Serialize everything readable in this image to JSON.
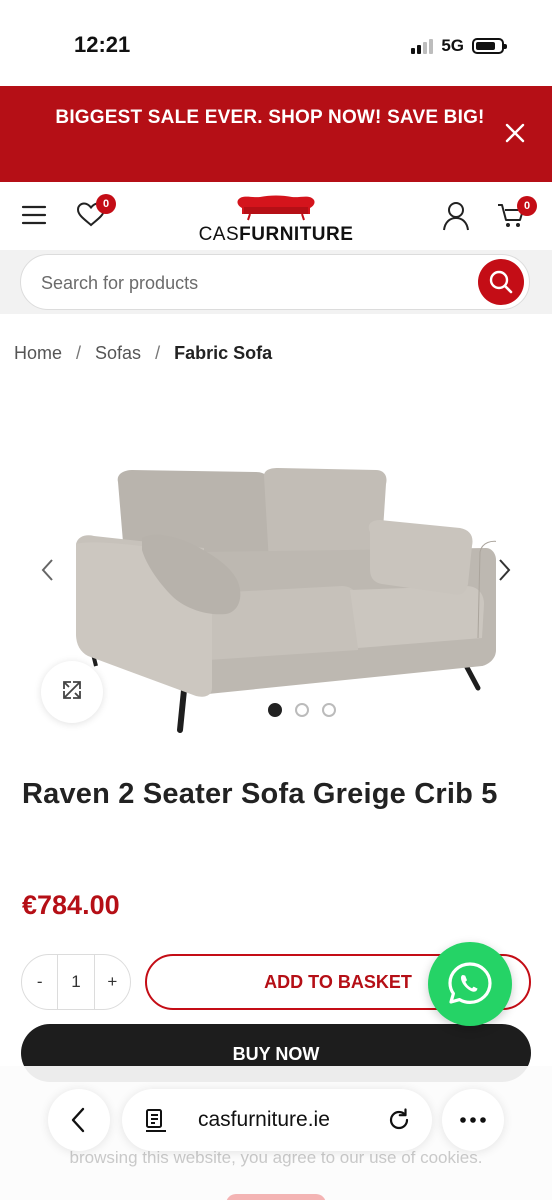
{
  "status_bar": {
    "time": "12:21",
    "network": "5G"
  },
  "promo": {
    "text": "BIGGEST SALE EVER.  SHOP NOW! SAVE BIG!"
  },
  "header": {
    "wishlist_count": "0",
    "cart_count": "0",
    "logo_prefix": "CAS",
    "logo_bold": "FURNITURE"
  },
  "search": {
    "placeholder": "Search for products"
  },
  "breadcrumb": {
    "home": "Home",
    "sep": "/",
    "category": "Sofas",
    "current": "Fabric Sofa"
  },
  "gallery": {
    "image_count": 3,
    "active_index": 0
  },
  "product": {
    "title": "Raven 2 Seater Sofa Greige Crib 5",
    "price": "€784.00"
  },
  "cart": {
    "minus": "-",
    "quantity": "1",
    "plus": "+",
    "add_label": "ADD TO BASKET",
    "buy_label": "BUY NOW"
  },
  "cookie": {
    "text": "browsing this website, you agree to our use of cookies."
  },
  "browser": {
    "url": "casfurniture.ie"
  },
  "colors": {
    "brand_red": "#b50f16",
    "whatsapp_green": "#25d366",
    "dark_button": "#1d1d1d"
  }
}
